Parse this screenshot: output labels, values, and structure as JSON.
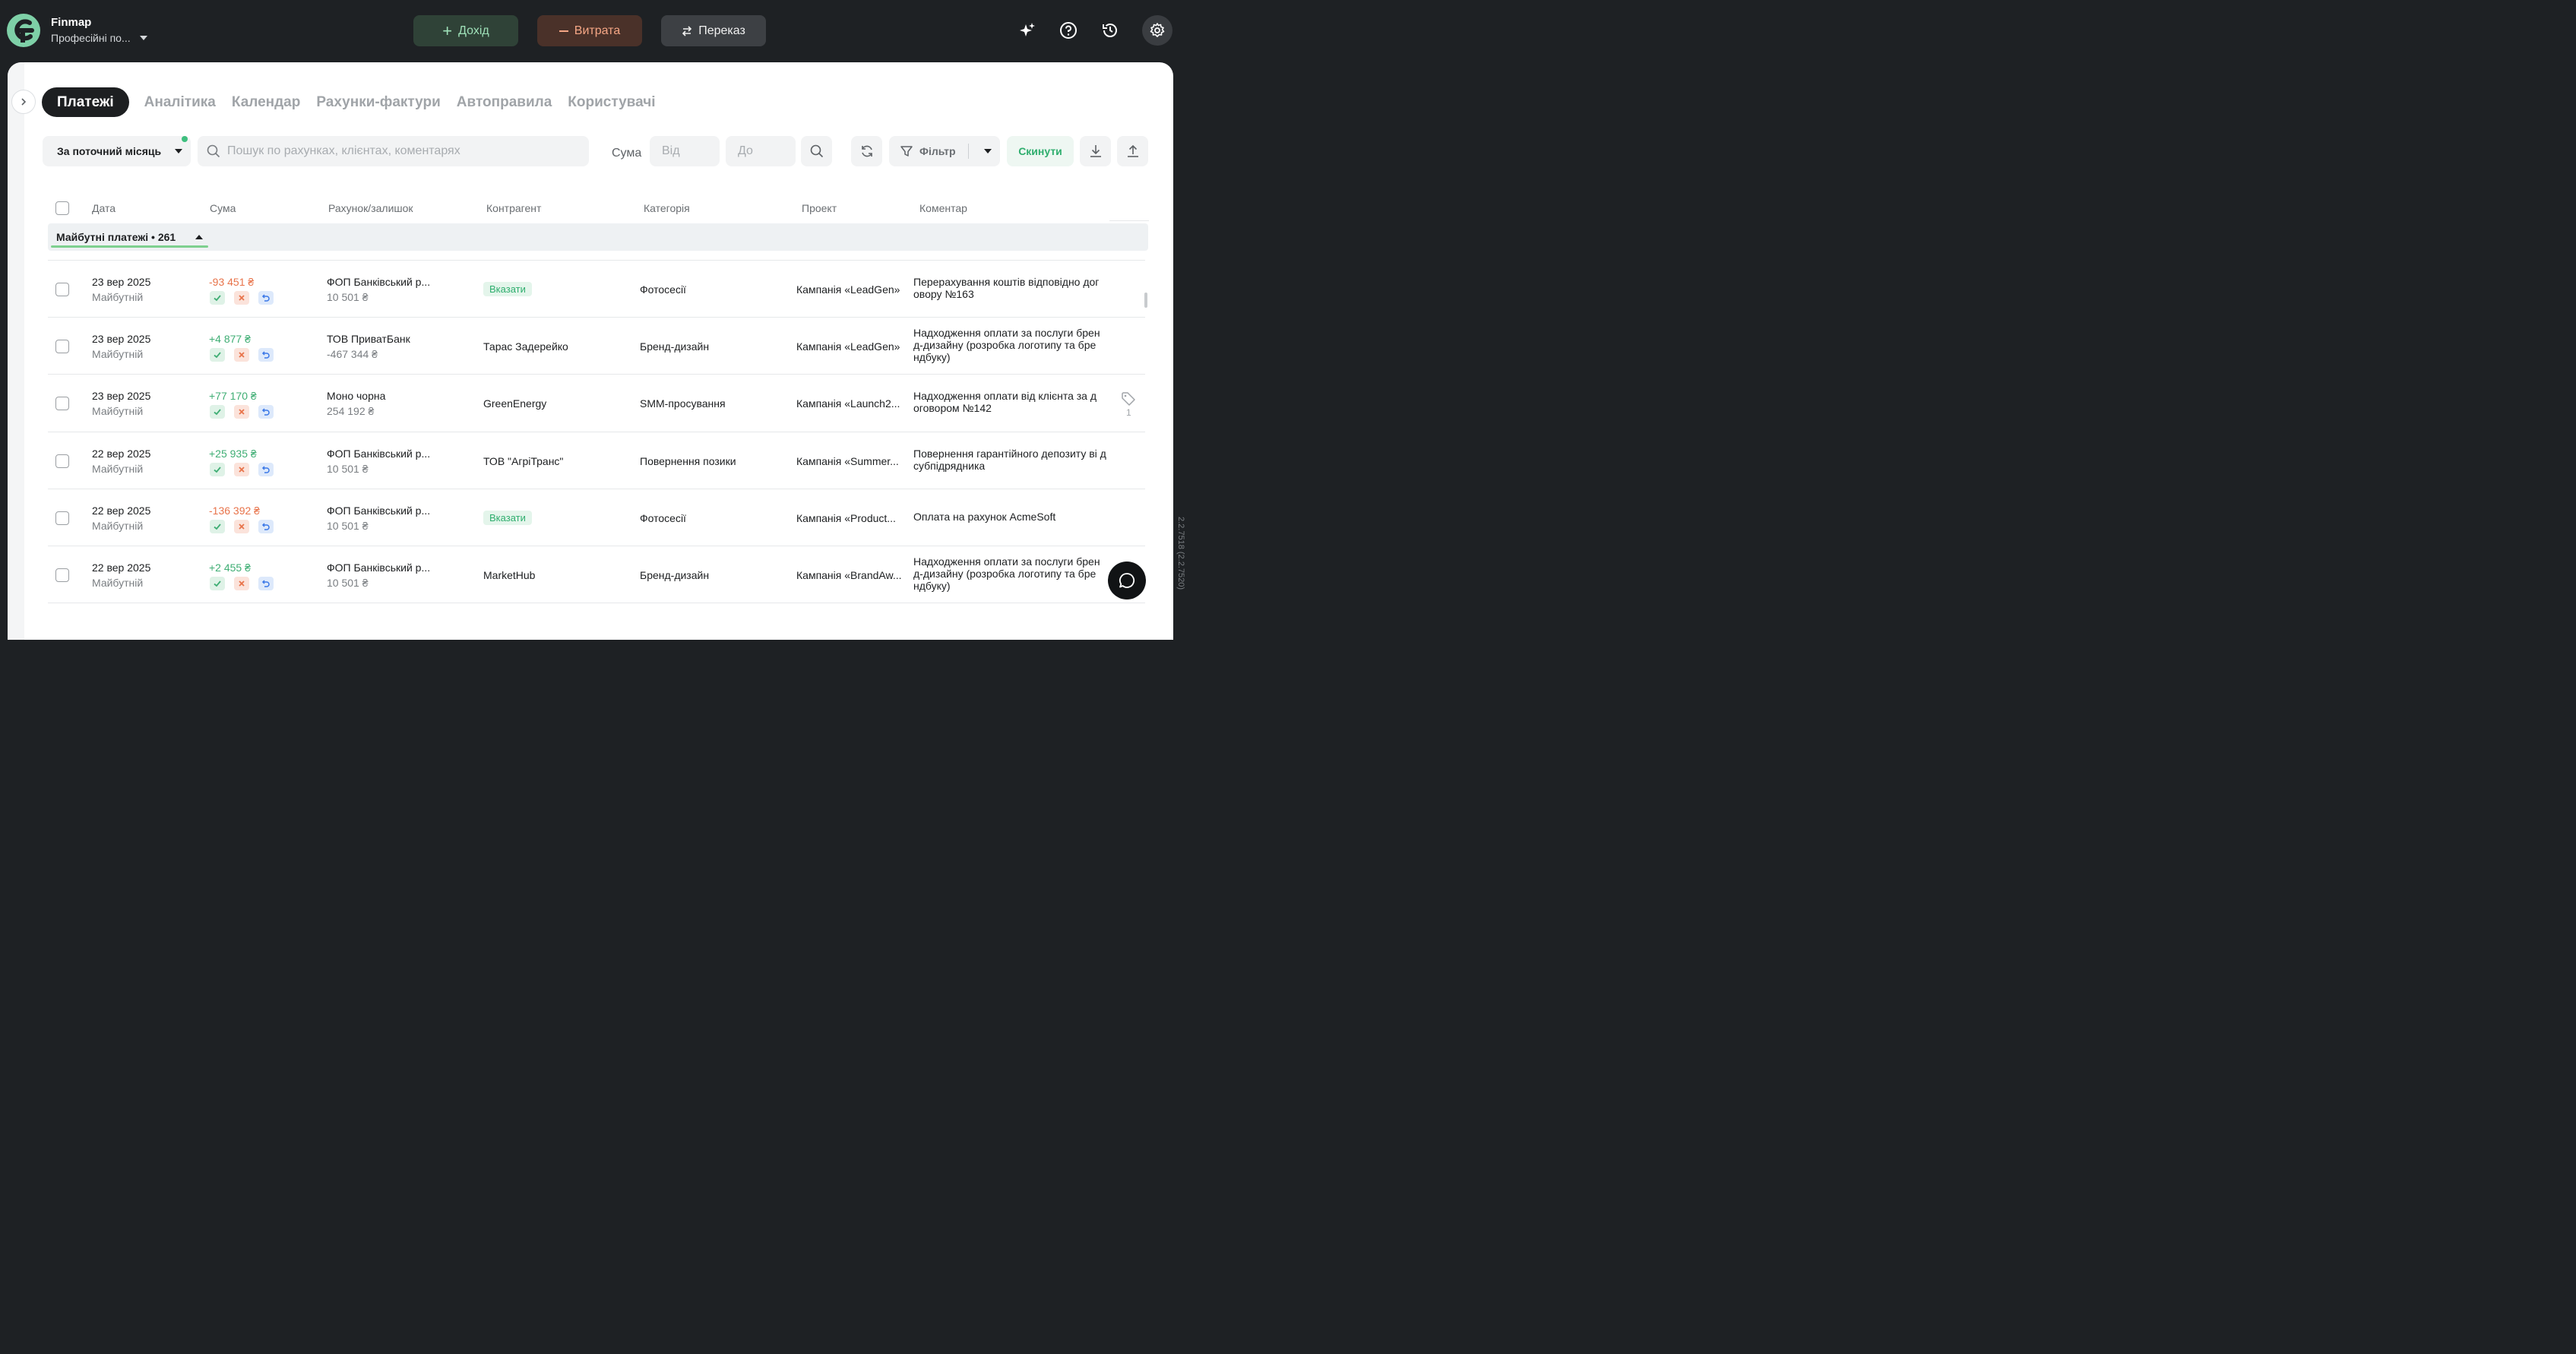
{
  "app": {
    "name": "Finmap",
    "workspace": "Професійні по..."
  },
  "topbar": {
    "income_label": "Дохід",
    "expense_label": "Витрата",
    "transfer_label": "Переказ",
    "icons": [
      "sparkle-icon",
      "help-icon",
      "history-icon",
      "settings-icon"
    ]
  },
  "tabs": [
    {
      "label": "Платежі",
      "active": true
    },
    {
      "label": "Аналітика",
      "active": false
    },
    {
      "label": "Календар",
      "active": false
    },
    {
      "label": "Рахунки-фактури",
      "active": false
    },
    {
      "label": "Автоправила",
      "active": false
    },
    {
      "label": "Користувачі",
      "active": false
    }
  ],
  "filters": {
    "period_label": "За поточний місяць",
    "search_placeholder": "Пошук по рахунках, клієнтах, коментарях",
    "sum_label": "Сума",
    "from_placeholder": "Від",
    "to_placeholder": "До",
    "filter_label": "Фільтр",
    "reset_label": "Скинути"
  },
  "table": {
    "columns": [
      "Дата",
      "Сума",
      "Рахунок/залишок",
      "Контрагент",
      "Категорія",
      "Проект",
      "Коментар"
    ],
    "group_label": "Майбутні платежі • 261",
    "rows": [
      {
        "date": "23 вер 2025",
        "status": "Майбутній",
        "amount": "-93 451 ₴",
        "sign": "neg",
        "account": "ФОП Банківський р...",
        "balance": "10 501 ₴",
        "counterparty": "Вказати",
        "counterparty_is_action": true,
        "category": "Фотосесії",
        "project": "Кампанія «LeadGen»",
        "comment": "Перерахування коштів відповідно дог овору №163"
      },
      {
        "date": "23 вер 2025",
        "status": "Майбутній",
        "amount": "+4 877 ₴",
        "sign": "pos",
        "account": "ТОВ ПриватБанк",
        "balance": "-467 344 ₴",
        "counterparty": "Тарас Задерейко",
        "counterparty_is_action": false,
        "category": "Бренд-дизайн",
        "project": "Кампанія «LeadGen»",
        "comment": "Надходження оплати за послуги брен д-дизайну (розробка логотипу та бре ндбуку)"
      },
      {
        "date": "23 вер 2025",
        "status": "Майбутній",
        "amount": "+77 170 ₴",
        "sign": "pos",
        "account": "Моно чорна",
        "balance": "254 192 ₴",
        "counterparty": "GreenEnergy",
        "counterparty_is_action": false,
        "category": "SMM-просування",
        "project": "Кампанія «Launch2...",
        "comment": "Надходження оплати від клієнта за д оговором №142",
        "tag_count": "1"
      },
      {
        "date": "22 вер 2025",
        "status": "Майбутній",
        "amount": "+25 935 ₴",
        "sign": "pos",
        "account": "ФОП Банківський р...",
        "balance": "10 501 ₴",
        "counterparty": "ТОВ \"АгріТранс\"",
        "counterparty_is_action": false,
        "category": "Повернення позики",
        "project": "Кампанія «Summer...",
        "comment": "Повернення гарантійного депозиту ві д субпідрядника"
      },
      {
        "date": "22 вер 2025",
        "status": "Майбутній",
        "amount": "-136 392 ₴",
        "sign": "neg",
        "account": "ФОП Банківський р...",
        "balance": "10 501 ₴",
        "counterparty": "Вказати",
        "counterparty_is_action": true,
        "category": "Фотосесії",
        "project": "Кампанія «Product...",
        "comment": "Оплата на рахунок AcmeSoft"
      },
      {
        "date": "22 вер 2025",
        "status": "Майбутній",
        "amount": "+2 455 ₴",
        "sign": "pos",
        "account": "ФОП Банківський р...",
        "balance": "10 501 ₴",
        "counterparty": "MarketHub",
        "counterparty_is_action": false,
        "category": "Бренд-дизайн",
        "project": "Кампанія «BrandAw...",
        "comment": "Надходження оплати за послуги брен д-дизайну (розробка логотипу та бре ндбуку)"
      }
    ]
  },
  "version": "2.2.7518 (2.2.7520)",
  "colors": {
    "income": "#3fae74",
    "expense": "#e8734a",
    "accent": "#2fae6e",
    "topbar_bg": "#1e2124"
  }
}
